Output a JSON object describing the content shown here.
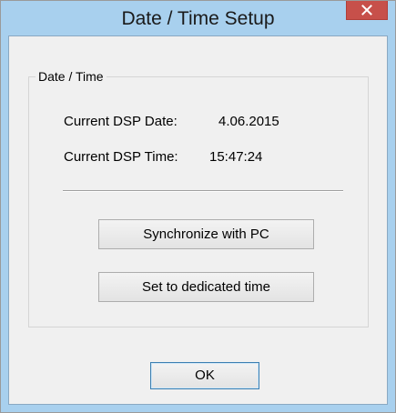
{
  "window": {
    "title": "Date / Time Setup",
    "close_glyph": "✕"
  },
  "group": {
    "label": "Date / Time",
    "date_label": "Current DSP Date:",
    "date_value": "4.06.2015",
    "time_label": "Current DSP Time:",
    "time_value": "15:47:24"
  },
  "buttons": {
    "sync_label": "Synchronize with PC",
    "set_label": "Set to dedicated time",
    "ok_label": "OK"
  },
  "colors": {
    "titlebar": "#a8d0ee",
    "close_button": "#c7504a",
    "client": "#f0f0f0"
  },
  "icons": {
    "close": "close-icon"
  }
}
